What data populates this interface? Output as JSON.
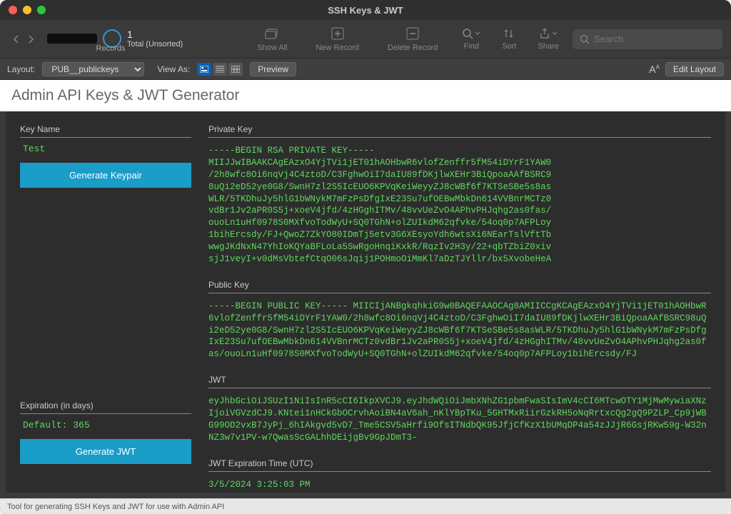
{
  "window": {
    "title": "SSH Keys & JWT"
  },
  "toolbar": {
    "record_count": "1",
    "record_status": "Total (Unsorted)",
    "records_label": "Records",
    "show_all": "Show All",
    "new_record": "New Record",
    "delete_record": "Delete Record",
    "find": "Find",
    "sort": "Sort",
    "share": "Share",
    "search_placeholder": "Search"
  },
  "layout_bar": {
    "layout_label": "Layout:",
    "layout_value": "PUB__publickeys",
    "view_as": "View As:",
    "preview": "Preview",
    "edit_layout": "Edit Layout"
  },
  "page": {
    "title": "Admin API Keys & JWT Generator"
  },
  "form": {
    "key_name_label": "Key Name",
    "key_name_value": "Test",
    "generate_keypair": "Generate Keypair",
    "expiration_label": "Expiration (in days)",
    "expiration_value": "Default: 365",
    "generate_jwt": "Generate JWT",
    "private_key_label": "Private Key",
    "private_key_value": "-----BEGIN RSA PRIVATE KEY-----\nMIIJJwIBAAKCAgEAzxO4YjTVi1jET01hAOHbwR6vlofZenffr5fM54iDYrF1YAW0\n/2h8wfc8Oi6nqVj4C4ztoD/C3FghwOiI7daIU89fDKjlwXEHr3BiQpoaAAfBSRC9\n8uQi2eD52ye0G8/SwnH7zl2S5IcEUO6KPVqKeiWeyyZJ8cWBf6f7KTSeSBe5s8as\nWLR/5TKDhuJy5hlG1bWNykM7mFzPsDfgIxE23Su7ufOEBwMbkDn614VVBnrMCTz0\nvdBr1Jv2aPR0S5j+xoeV4jfd/4zHGghITMv/48vvUeZvO4APhvPHJqhg2as0fas/\nouoLn1uHf0978S0MXfvoTodWyU+SQ0TGhN+olZUIkdM62qfvke/54oq0p7AFPLoy\n1bihErcsdy/FJ+QwoZ7ZkYO80IDmTj5etv3G6XEsyoYdh6wtsXi6NEarTslVftTb\nwwgJKdNxN47YhIoKQYaBFLoLa5SwRgoHnqiKxkR/RqzIv2H3y/22+qbTZbiZ0xiv\nsjJ1veyI+v0dMsVbtefCtqO06sJqij1POHmoOiMmKl7aDzTJYllr/bx5XvobeHeA",
    "public_key_label": "Public Key",
    "public_key_value": "-----BEGIN PUBLIC KEY-----\nMIICIjANBgkqhkiG9w0BAQEFAAOCAg8AMIICCgKCAgEAzxO4YjTVi1jET01hAOHbwR6vlofZenffr5fM54iDYrF1YAW0/2h8wfc8Oi6nqVj4C4ztoD/C3FghwOiI7daIU89fDKjlwXEHr3BiQpoaAAfBSRC98uQi2eD52ye0G8/SwnH7zl2S5IcEUO6KPVqKeiWeyyZJ8cWBf6f7KTSeSBe5s8asWLR/5TKDhuJy5hlG1bWNykM7mFzPsDfgIxE23Su7ufOEBwMbkDn614VVBnrMCTz0vdBr1Jv2aPR0S5j+xoeV4jfd/4zHGghITMv/48vvUeZvO4APhvPHJqhg2as0fas/ouoLn1uHf0978S0MXfvoTodWyU+SQ0TGhN+olZUIkdM62qfvke/54oq0p7AFPLoy1bihErcsdy/FJ",
    "jwt_label": "JWT",
    "jwt_value": "eyJhbGciOiJSUzI1NiIsInR5cCI6IkpXVCJ9.eyJhdWQiOiJmbXNhZG1pbmFwaSIsImV4cCI6MTcwOTY1MjMwMywiaXNzIjoiVGVzdCJ9.KNtei1nHCkGbOCrvhAoiBN4aV6ah_nKlYBpTKu_5GHTMxRiirGzkRH5oNqRrtxcQg2gQ9PZLP_Cp9jWBG99OD2vxB7JyPj_6hIAkgvd5vD7_Tme5CSV5aHrfi9OfsITNdbQK95JfjCfKzX1bUMqDP4a54zJJjR6GsjRKw59g-W32nNZ3w7v1PV-w7QwasScGALhhDEijgBv9GpJDmT3-",
    "jwt_exp_label": "JWT Expiration Time (UTC)",
    "jwt_exp_value": "3/5/2024 3:25:03 PM"
  },
  "footer": {
    "text": "Tool for generating SSH Keys and JWT for use with Admin API"
  }
}
